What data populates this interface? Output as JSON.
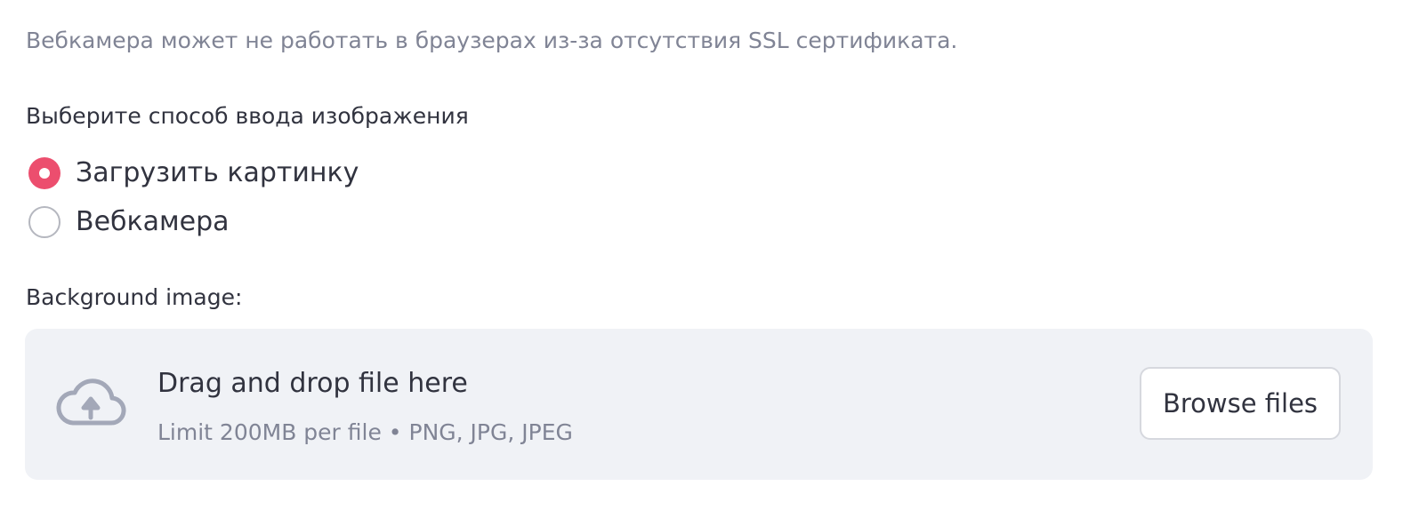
{
  "notice": {
    "text": "Вебкамера может не работать в браузерах из-за отсутствия SSL сертификата."
  },
  "input_method": {
    "label": "Выберите способ ввода изображения",
    "options": [
      {
        "label": "Загрузить картинку",
        "selected": true
      },
      {
        "label": "Вебкамера",
        "selected": false
      }
    ]
  },
  "uploader": {
    "label": "Background image:",
    "icon": "cloud-upload-icon",
    "title": "Drag and drop file here",
    "hint": "Limit 200MB per file • PNG, JPG, JPEG",
    "button_label": "Browse files"
  },
  "colors": {
    "accent": "#ec4e6e",
    "text_primary": "#31333f",
    "text_muted": "#808495",
    "dropzone_bg": "#f0f2f6",
    "icon": "#a3a8b8"
  }
}
